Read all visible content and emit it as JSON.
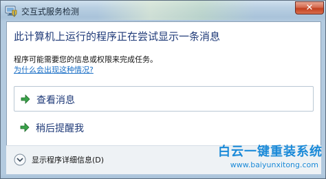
{
  "window": {
    "title": "交互式服务检测",
    "close_label": "✕",
    "app_icon": "shield-monitor-icon"
  },
  "dialog": {
    "heading": "此计算机上运行的程序正在尝试显示一条消息",
    "description": "程序可能需要您的信息或权限来完成任务。",
    "help_link": "为什么会出现这种情况?",
    "options": [
      {
        "label": "查看消息",
        "icon": "green-arrow-icon",
        "selected": true
      },
      {
        "label": "稍后提醒我",
        "icon": "green-arrow-icon",
        "selected": false
      }
    ],
    "details_label": "显示程序详细信息(D)",
    "details_icon": "expand-chevron-icon"
  },
  "watermark": {
    "title": "白云一键重装系统",
    "url": "www.baiyunxitong.com"
  },
  "colors": {
    "heading": "#1f3a78",
    "link": "#1a6fc6",
    "arrow": "#3aa34a",
    "close": "#c2401f",
    "watermark": "#1b8ad8"
  }
}
